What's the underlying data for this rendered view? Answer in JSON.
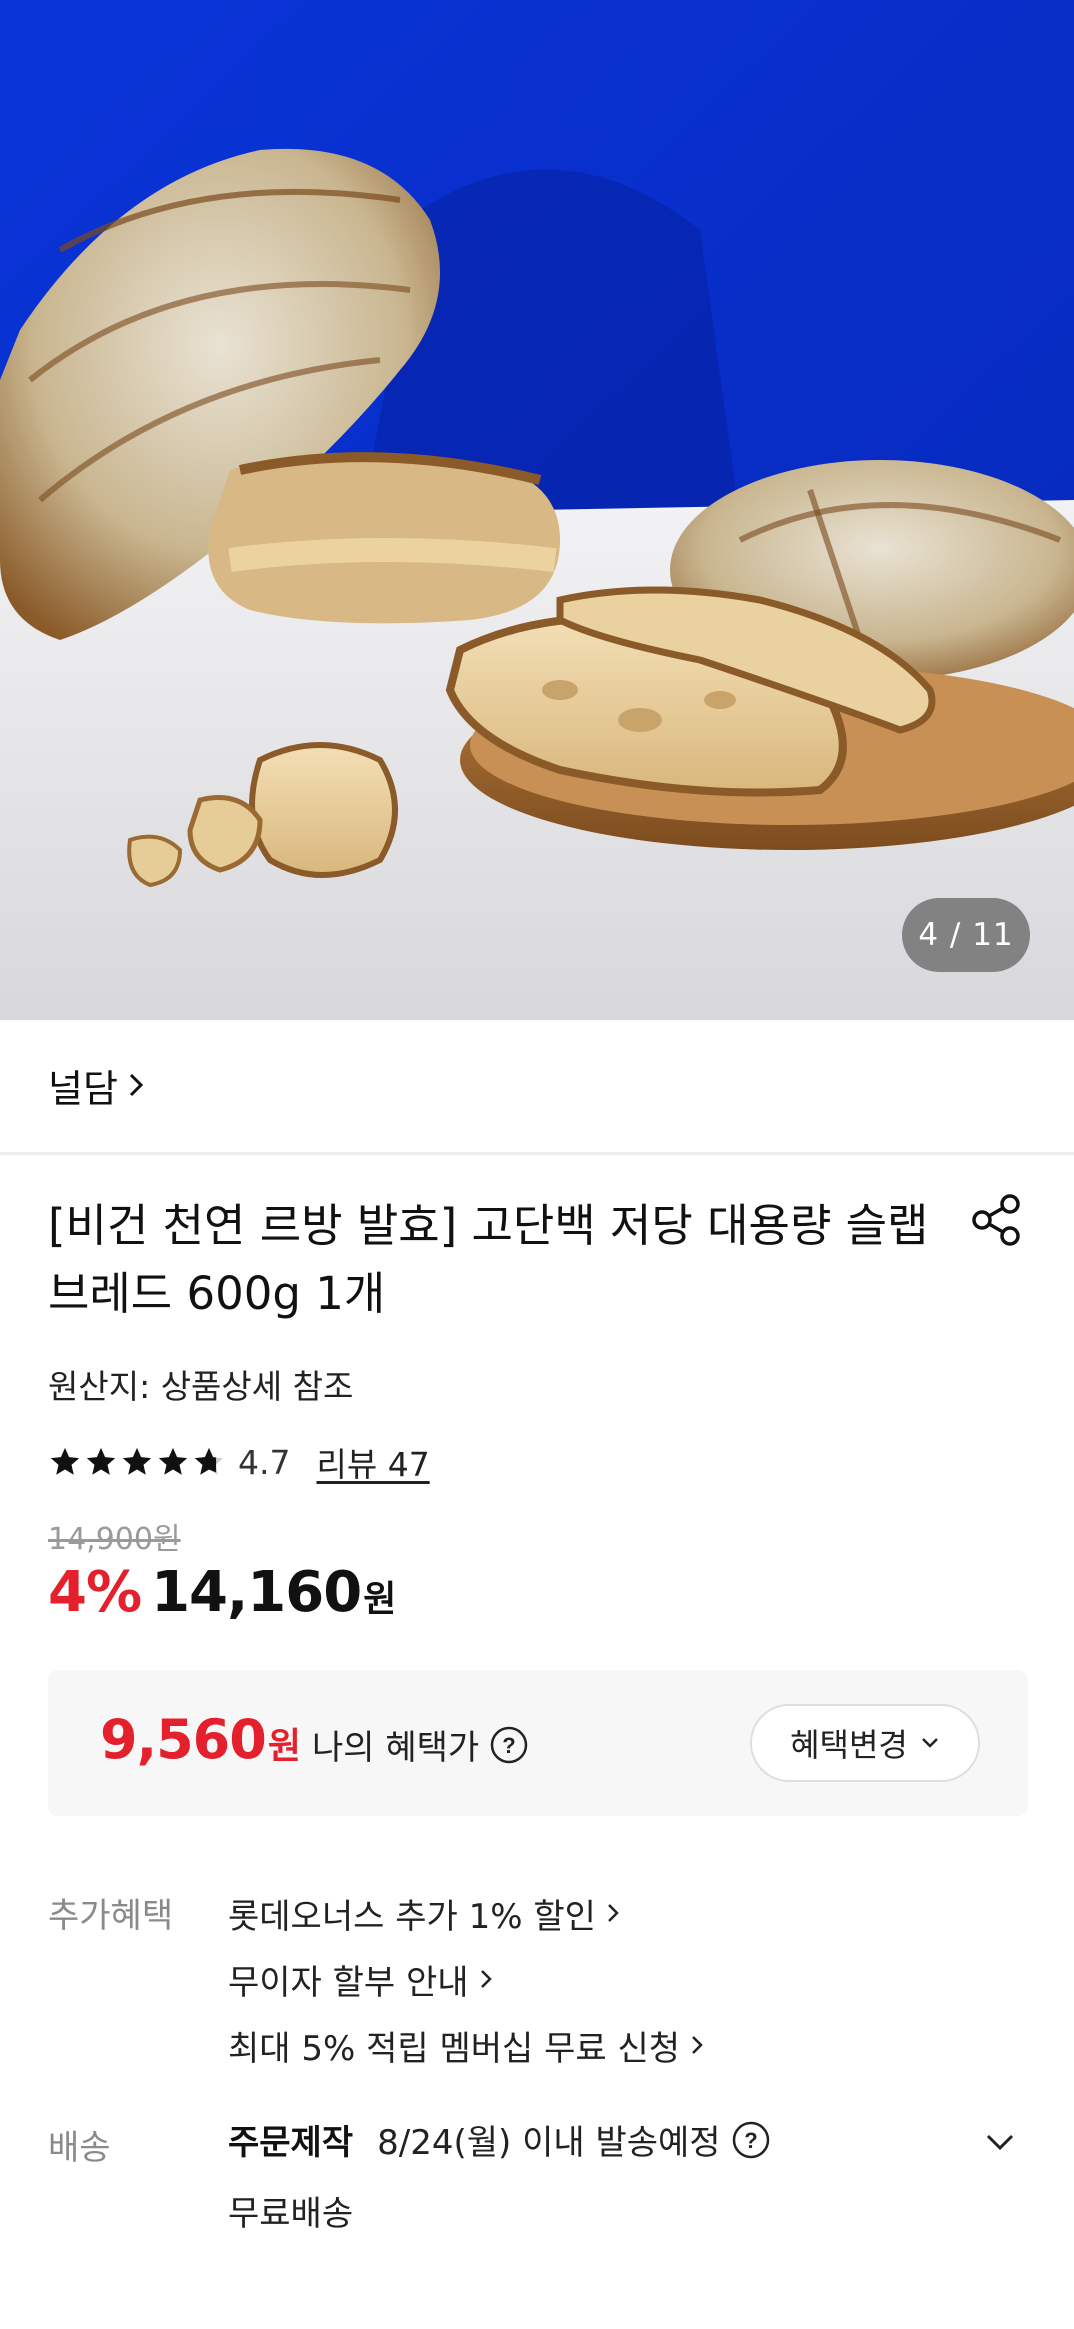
{
  "gallery": {
    "indicator": "4 / 11"
  },
  "brand": {
    "name": "널담"
  },
  "product": {
    "title": "[비건 천연 르방 발효] 고단백 저당 대용량 슬랩 브레드 600g 1개",
    "origin": "원산지: 상품상세 참조"
  },
  "rating": {
    "value": "4.7",
    "stars": 4.7,
    "review_link": "리뷰 47"
  },
  "price": {
    "original": "14,900원",
    "discount": "4%",
    "sale": "14,160",
    "unit": "원"
  },
  "benefit": {
    "price": "9,560",
    "unit": "원",
    "label": "나의 혜택가",
    "change_button": "혜택변경"
  },
  "extra_benefits": {
    "label": "추가혜택",
    "items": [
      {
        "text": "롯데오너스 추가 1% 할인"
      },
      {
        "text": "무이자 할부 안내"
      },
      {
        "text": "최대 5% 적립 멤버십 무료 신청"
      }
    ]
  },
  "delivery": {
    "label": "배송",
    "type": "주문제작",
    "date": "8/24(월) 이내 발송예정",
    "fee": "무료배송"
  },
  "colors": {
    "accent": "#e3202b",
    "hero_bg": "#0a2fd0"
  }
}
